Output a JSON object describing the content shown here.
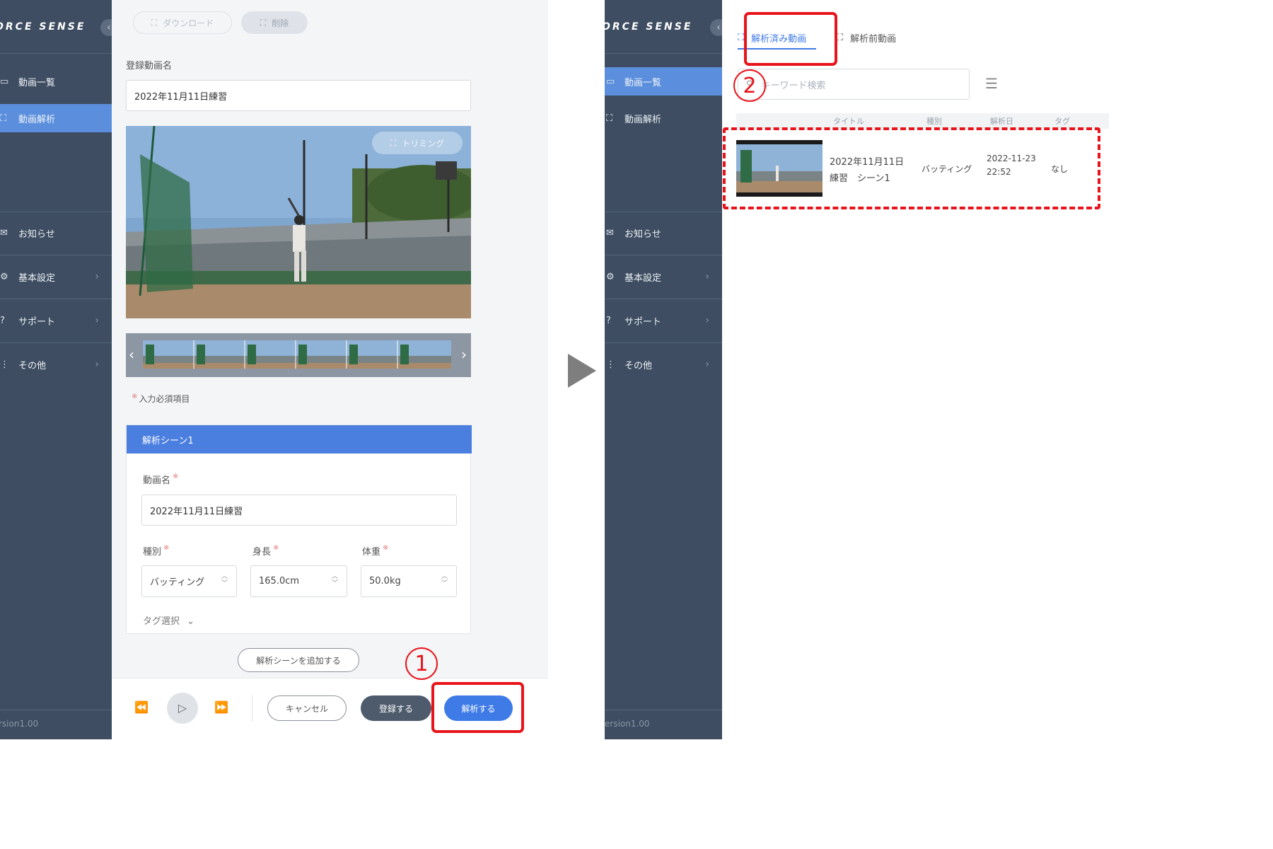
{
  "left_screen": {
    "sidebar": {
      "brand": "ORCE SENSE",
      "collapse_icon": "chevron-left-icon",
      "items": [
        {
          "label": "動画一覧",
          "icon": "video-list-icon",
          "active": false
        },
        {
          "label": "動画解析",
          "icon": "analyze-icon",
          "active": true
        },
        {
          "label": "お知らせ",
          "icon": "mail-icon",
          "active": false
        },
        {
          "label": "基本設定",
          "icon": "gear-icon",
          "active": false
        },
        {
          "label": "サポート",
          "icon": "help-icon",
          "active": false
        },
        {
          "label": "その他",
          "icon": "more-icon",
          "active": false
        }
      ],
      "version": "rsion1.00"
    },
    "toolbar": {
      "download_label": "ダウンロード",
      "delete_label": "削除"
    },
    "title_label": "登録動画名",
    "title_value": "2022年11月11日練習",
    "trimming_label": "トリミング",
    "required_note": "入力必須項目",
    "scene": {
      "header": "解析シーン1",
      "name_label": "動画名",
      "name_value": "2022年11月11日練習",
      "type_label": "種別",
      "type_value": "バッティング",
      "height_label": "身長",
      "height_value": "165.0cm",
      "weight_label": "体重",
      "weight_value": "50.0kg",
      "tag_label": "タグ選択"
    },
    "add_scene_label": "解析シーンを追加する",
    "bottom_bar": {
      "cancel": "キャンセル",
      "register": "登録する",
      "analyze": "解析する"
    },
    "step_marker": "1"
  },
  "arrow_icon": "arrow-right-icon",
  "right_screen": {
    "sidebar": {
      "brand": "ORCE SENSE",
      "items": [
        {
          "label": "動画一覧",
          "icon": "video-list-icon",
          "active": true
        },
        {
          "label": "動画解析",
          "icon": "analyze-icon",
          "active": false
        },
        {
          "label": "お知らせ",
          "icon": "mail-icon",
          "active": false
        },
        {
          "label": "基本設定",
          "icon": "gear-icon",
          "active": false
        },
        {
          "label": "サポート",
          "icon": "help-icon",
          "active": false
        },
        {
          "label": "その他",
          "icon": "more-icon",
          "active": false
        }
      ],
      "version": "ersion1.00"
    },
    "tabs": [
      {
        "label": "解析済み動画",
        "active": true
      },
      {
        "label": "解析前動画",
        "active": false
      }
    ],
    "search_placeholder": "キーワード検索",
    "table_headers": [
      "タイトル",
      "種別",
      "解析日",
      "タグ"
    ],
    "row": {
      "title_line1": "2022年11月11日",
      "title_line2": "練習　シーン1",
      "type": "バッティング",
      "date": "2022-11-23",
      "time": "22:52",
      "tag": "なし"
    },
    "step_marker": "2"
  },
  "colors": {
    "sidebar": "#3e4d61",
    "accent": "#4b7fdf",
    "annotation": "#e8141b"
  }
}
